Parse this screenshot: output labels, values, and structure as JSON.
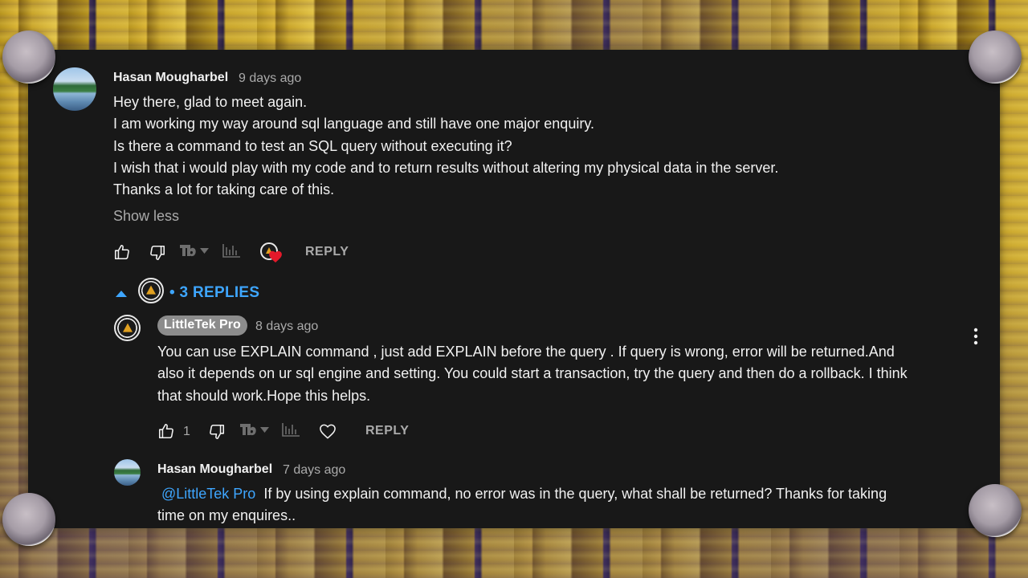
{
  "comment": {
    "author": "Hasan Mougharbel",
    "time": "9 days ago",
    "lines": [
      "Hey there, glad to meet again.",
      "I am working my way around sql language and still have one major enquiry.",
      "Is there a command to test an SQL query without executing it?",
      "I wish that i would play with my code and to return results without altering my physical data in the server.",
      "Thanks a lot for taking care of this."
    ],
    "show_less": "Show less",
    "reply_label": "REPLY"
  },
  "replies_toggle": {
    "label": "• 3 REPLIES"
  },
  "reply1": {
    "author": "LittleTek Pro",
    "time": "8 days ago",
    "lines": [
      "You can use EXPLAIN command , just add EXPLAIN before the query . If query is wrong, error will be returned.And",
      "also it depends on ur sql engine and setting. You could start a transaction, try the query and then do a rollback. I think",
      "that should work.Hope this helps."
    ],
    "like_count": "1",
    "reply_label": "REPLY"
  },
  "reply2": {
    "author": "Hasan Mougharbel",
    "time": "7 days ago",
    "mention": "@LittleTek Pro",
    "line1_rest": "If by using explain command, no error was in the query, what shall be returned? Thanks for taking",
    "line2": "time on my enquires.."
  },
  "colors": {
    "panel_bg": "#181818",
    "link_blue": "#3ea6ff",
    "heart_red": "#e5192a",
    "muted": "#aaaaaa"
  },
  "icons": [
    "thumbs-up-icon",
    "thumbs-down-icon",
    "tubebuddy-icon",
    "analytics-icon",
    "hearted-icon",
    "heart-outline-icon",
    "caret-up-icon",
    "more-vertical-icon"
  ]
}
